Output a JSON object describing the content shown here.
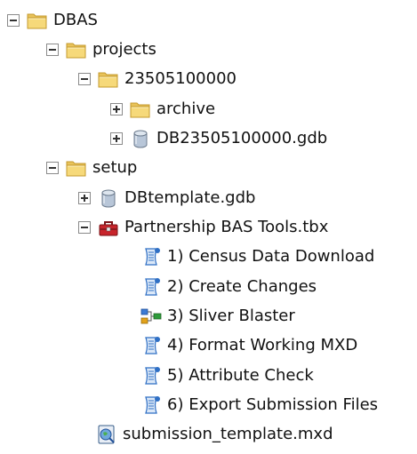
{
  "tree": {
    "root": {
      "label": "DBAS",
      "icon": "folder-icon",
      "expander": "collapse"
    },
    "projects": {
      "label": "projects",
      "icon": "folder-icon",
      "expander": "collapse"
    },
    "project_23505100000": {
      "label": "23505100000",
      "icon": "folder-icon",
      "expander": "collapse"
    },
    "archive": {
      "label": "archive",
      "icon": "folder-icon",
      "expander": "expand"
    },
    "project_gdb": {
      "label": "DB23505100000.gdb",
      "icon": "geodatabase-icon",
      "expander": "expand"
    },
    "setup": {
      "label": "setup",
      "icon": "folder-icon",
      "expander": "collapse"
    },
    "template_gdb": {
      "label": "DBtemplate.gdb",
      "icon": "geodatabase-icon",
      "expander": "expand"
    },
    "toolbox": {
      "label": "Partnership BAS Tools.tbx",
      "icon": "toolbox-icon",
      "expander": "collapse"
    },
    "tools": [
      {
        "label": "1) Census Data Download",
        "icon": "script-tool-icon"
      },
      {
        "label": "2) Create Changes",
        "icon": "script-tool-icon"
      },
      {
        "label": "3) Sliver Blaster",
        "icon": "model-tool-icon"
      },
      {
        "label": "4) Format Working MXD",
        "icon": "script-tool-icon"
      },
      {
        "label": "5) Attribute Check",
        "icon": "script-tool-icon"
      },
      {
        "label": "6) Export Submission Files",
        "icon": "script-tool-icon"
      }
    ],
    "mxd": {
      "label": "submission_template.mxd",
      "icon": "map-document-icon"
    }
  },
  "colors": {
    "folder_fill": "#f6d97a",
    "folder_edge": "#c49a2c",
    "gdb_fill": "#b8c6d8",
    "toolbox_red": "#c8242b",
    "script_blue": "#2f6fc4",
    "model_green": "#2e9b3a"
  }
}
